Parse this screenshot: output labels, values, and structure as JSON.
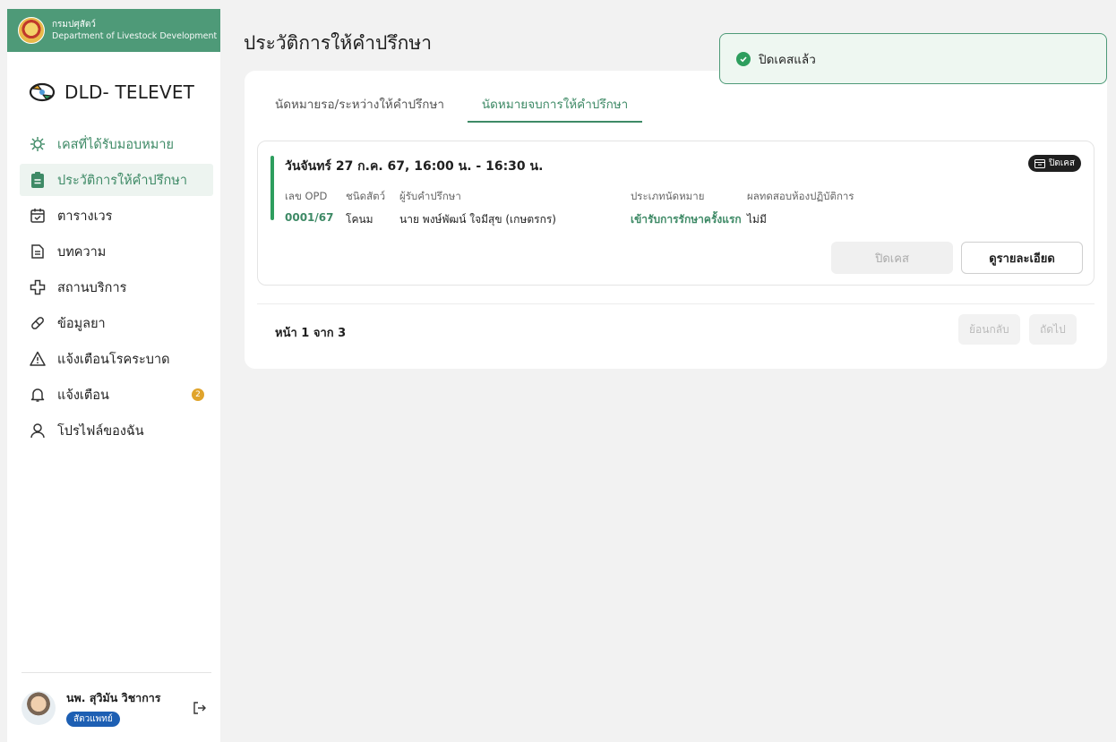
{
  "sidebar": {
    "department_th": "กรมปศุสัตว์",
    "department_en": "Department of Livestock Development",
    "brand": "DLD- TELEVET",
    "items": [
      {
        "label": "เคสที่ได้รับมอบหมาย",
        "icon": "virus-icon"
      },
      {
        "label": "ประวัติการให้คำปรึกษา",
        "icon": "clipboard-icon",
        "active": true
      },
      {
        "label": "ตารางเวร",
        "icon": "calendar-check-icon"
      },
      {
        "label": "บทความ",
        "icon": "document-icon"
      },
      {
        "label": "สถานบริการ",
        "icon": "medical-cross-icon"
      },
      {
        "label": "ข้อมูลยา",
        "icon": "pill-icon"
      },
      {
        "label": "แจ้งเตือนโรคระบาด",
        "icon": "warning-triangle-icon"
      },
      {
        "label": "แจ้งเตือน",
        "icon": "bell-icon",
        "badge": "2"
      },
      {
        "label": "โปรไฟล์ของฉัน",
        "icon": "user-icon"
      }
    ],
    "profile": {
      "name": "นพ. สุวิมัน วิชาการ",
      "role": "สัตวแพทย์"
    }
  },
  "header": {
    "title": "ประวัติการให้คำปรึกษา"
  },
  "tabs": [
    {
      "label": "นัดหมายรอ/ระหว่างให้คำปรึกษา"
    },
    {
      "label": "นัดหมายจบการให้คำปรึกษา",
      "active": true
    }
  ],
  "appointment": {
    "date": "วันจันทร์ 27 ก.ค. 67, 16:00 น. - 16:30 น.",
    "status": "ปิดเคส",
    "fields": {
      "opd_label": "เลข OPD",
      "opd_value": "0001/67",
      "animal_label": "ชนิดสัตว์",
      "animal_value": "โคนม",
      "client_label": "ผู้รับคำปรึกษา",
      "client_value": "นาย พงษ์พัฒน์ ใจมีสุข (เกษตรกร)",
      "type_label": "ประเภทนัดหมาย",
      "type_value": "เข้ารับการรักษาครั้งแรก",
      "lab_label": "ผลทดสอบห้องปฏิบัติการ",
      "lab_value": "ไม่มี"
    },
    "close_button": "ปิดเคส",
    "detail_button": "ดูรายละเอียด"
  },
  "pagination": {
    "text": "หน้า 1 จาก 3",
    "prev": "ย้อนกลับ",
    "next": "ถัดไป"
  },
  "toast": {
    "message": "ปิดเคสแล้ว"
  },
  "colors": {
    "brand_green": "#4e9a78",
    "accent_green": "#3e8a66",
    "status_green": "#2e9e5e",
    "badge_orange": "#e0a42c",
    "role_blue": "#1d5fb3"
  }
}
